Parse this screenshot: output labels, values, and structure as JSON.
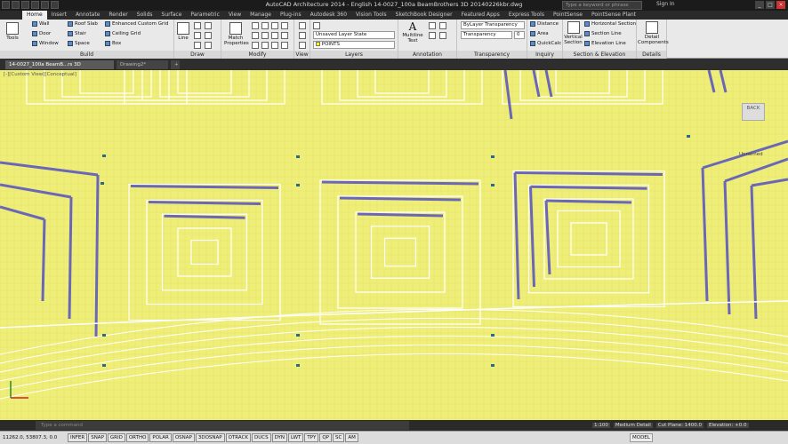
{
  "title_bar": {
    "title": "AutoCAD Architecture 2014 - English   14-0027_100a BeamBrothers 3D 20140226kbr.dwg",
    "search_placeholder": "Type a keyword or phrase",
    "sign_in": "Sign In"
  },
  "ribbon_tabs": [
    "Home",
    "Insert",
    "Annotate",
    "Render",
    "Solids",
    "Surface",
    "Parametric",
    "View",
    "Manage",
    "Plug-ins",
    "Autodesk 360",
    "Vision Tools",
    "SketchBook Designer",
    "Featured Apps",
    "Express Tools",
    "PointSense",
    "PointSense Plant"
  ],
  "active_tab": "Home",
  "panels": {
    "build": {
      "name": "Build",
      "tools_label": "Tools",
      "col1": [
        "Wall",
        "Door",
        "Window"
      ],
      "col2": [
        "Roof Slab",
        "Stair",
        "Space"
      ],
      "col3": [
        "Enhanced Custom Grid",
        "Ceiling Grid",
        "Box"
      ]
    },
    "draw": {
      "name": "Draw",
      "line_label": "Line"
    },
    "modify": {
      "name": "Modify",
      "match_label": "Match Properties"
    },
    "view": {
      "name": "View"
    },
    "layers": {
      "name": "Layers",
      "layer_state": "Unsaved Layer State",
      "current_layer": "POINTS"
    },
    "annotation": {
      "name": "Annotation",
      "mtext_label": "Multiline Text"
    },
    "transparency": {
      "name": "Transparency",
      "bylayer": "ByLayer Transparency",
      "transparency": "Transparency",
      "value": "0"
    },
    "inquiry": {
      "name": "Inquiry",
      "items": [
        "Distance",
        "Area",
        "QuickCalc"
      ]
    },
    "section": {
      "name": "Section & Elevation",
      "vertical_section": "Vertical Section",
      "items": [
        "Horizontal Section",
        "Section Line",
        "Elevation Line"
      ]
    },
    "details": {
      "name": "Details",
      "detail_components": "Detail Components"
    }
  },
  "doc_tabs": [
    "14-0027_100a BeamB...rs 3D 20140226kbr*",
    "Drawing2*"
  ],
  "viewport": {
    "label": "[-][Custom View][Conceptual]",
    "viewcube": "BACK",
    "wcs": "Unnamed"
  },
  "command_line": {
    "placeholder": "Type a command"
  },
  "status": {
    "coords": "11262.0, 53807.3, 0.0",
    "toggles": [
      "INFER",
      "SNAP",
      "GRID",
      "ORTHO",
      "POLAR",
      "OSNAP",
      "3DOSNAP",
      "OTRACK",
      "DUCS",
      "DYN",
      "LWT",
      "TPY",
      "QP",
      "SC",
      "AM"
    ],
    "model": "MODEL",
    "scale": "1:100",
    "detail": "Medium Detail",
    "cut_plane": "Cut Plane: 1400.0",
    "elevation": "Elevation: +0.0"
  },
  "colors": {
    "viewport_bg": "#efee78",
    "ribbon_bg": "#e9e9e9",
    "beam": "#6b67b8"
  }
}
